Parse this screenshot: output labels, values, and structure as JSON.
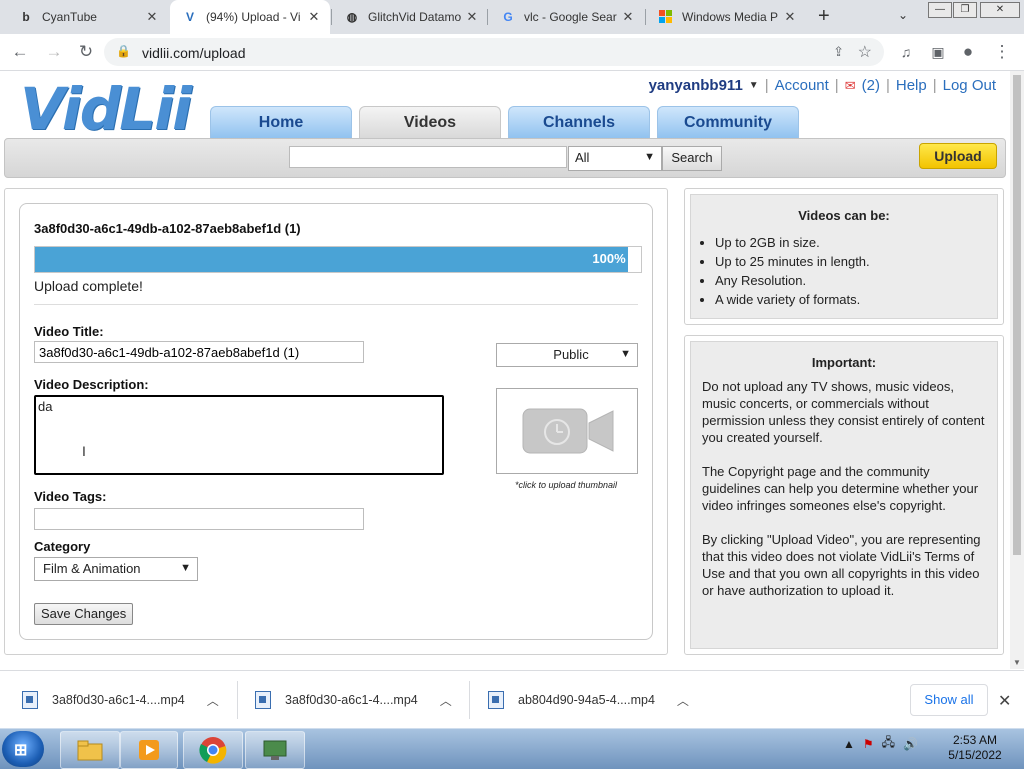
{
  "browser": {
    "tabs": [
      {
        "title": "CyanTube",
        "favicon": "b"
      },
      {
        "title": "(94%) Upload - Vi",
        "favicon": "V"
      },
      {
        "title": "GlitchVid Datamo",
        "favicon": "globe"
      },
      {
        "title": "vlc - Google Sear",
        "favicon": "G"
      },
      {
        "title": "Windows Media P",
        "favicon": "windows"
      }
    ],
    "url": "vidlii.com/upload"
  },
  "site": {
    "logo": "VidLii",
    "username": "yanyanbb911",
    "account_label": "Account",
    "messages_count": "(2)",
    "help_label": "Help",
    "logout_label": "Log Out",
    "nav": [
      "Home",
      "Videos",
      "Channels",
      "Community"
    ],
    "search": {
      "value": "",
      "filter": "All",
      "button": "Search"
    },
    "upload_button": "Upload"
  },
  "upload": {
    "file_title": "3a8f0d30-a6c1-49db-a102-87aeb8abef1d (1)",
    "progress_percent": 100,
    "progress_label": "100%",
    "status": "Upload complete!",
    "title_label": "Video Title:",
    "title_value": "3a8f0d30-a6c1-49db-a102-87aeb8abef1d (1)",
    "privacy": "Public",
    "description_label": "Video Description:",
    "description_value": "da",
    "thumbnail_note": "*click to upload thumbnail",
    "tags_label": "Video Tags:",
    "tags_value": "",
    "category_label": "Category",
    "category_value": "Film & Animation",
    "save_button": "Save Changes"
  },
  "sidebar": {
    "can_be": {
      "heading": "Videos can be:",
      "items": [
        "Up to 2GB in size.",
        "Up to 25 minutes in length.",
        "Any Resolution.",
        "A wide variety of formats."
      ]
    },
    "important": {
      "heading": "Important:",
      "paragraphs": [
        "Do not upload any TV shows, music videos, music concerts, or commercials without permission unless they consist entirely of content you created yourself.",
        "The Copyright page and the community guidelines can help you determine whether your video infringes someones else's copyright.",
        "By clicking \"Upload Video\", you are representing that this video does not violate VidLii's Terms of Use and that you own all copyrights in this video or have authorization to upload it."
      ]
    }
  },
  "downloads": {
    "items": [
      "3a8f0d30-a6c1-4....mp4",
      "3a8f0d30-a6c1-4....mp4",
      "ab804d90-94a5-4....mp4"
    ],
    "show_all": "Show all"
  },
  "taskbar": {
    "time": "2:53 AM",
    "date": "5/15/2022"
  }
}
